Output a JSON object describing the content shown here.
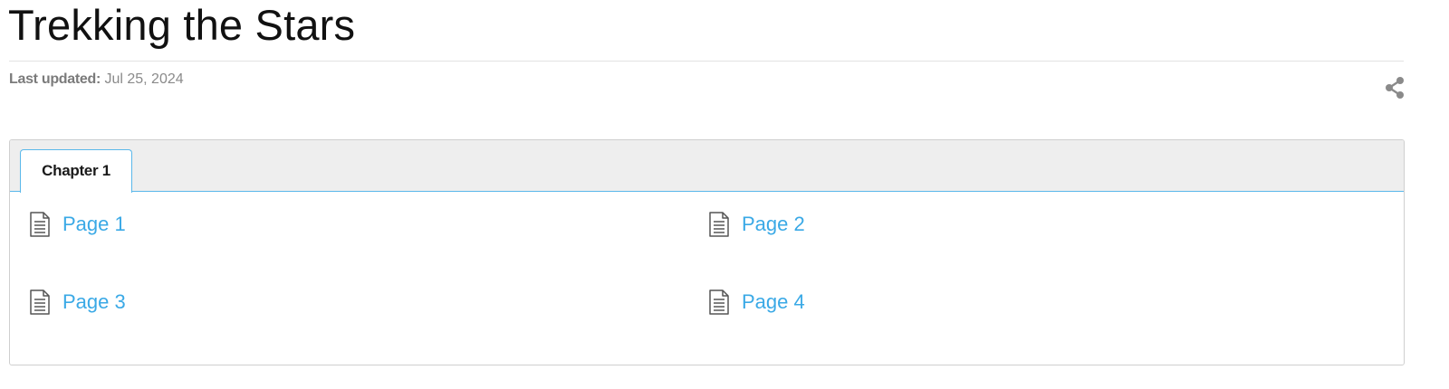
{
  "header": {
    "title": "Trekking the Stars",
    "last_updated_label": "Last updated:",
    "last_updated_value": "Jul 25, 2024",
    "share_icon": "share-icon"
  },
  "toc": {
    "tabs": [
      {
        "label": "Chapter 1",
        "active": true
      }
    ],
    "pages": [
      {
        "label": "Page 1",
        "icon": "document-icon"
      },
      {
        "label": "Page 2",
        "icon": "document-icon"
      },
      {
        "label": "Page 3",
        "icon": "document-icon"
      },
      {
        "label": "Page 4",
        "icon": "document-icon"
      }
    ]
  },
  "colors": {
    "link": "#3aa9e6",
    "tab_border": "#5ab8ea",
    "tab_strip_bg": "#eeeeee",
    "meta_text": "#8a8a8a"
  }
}
